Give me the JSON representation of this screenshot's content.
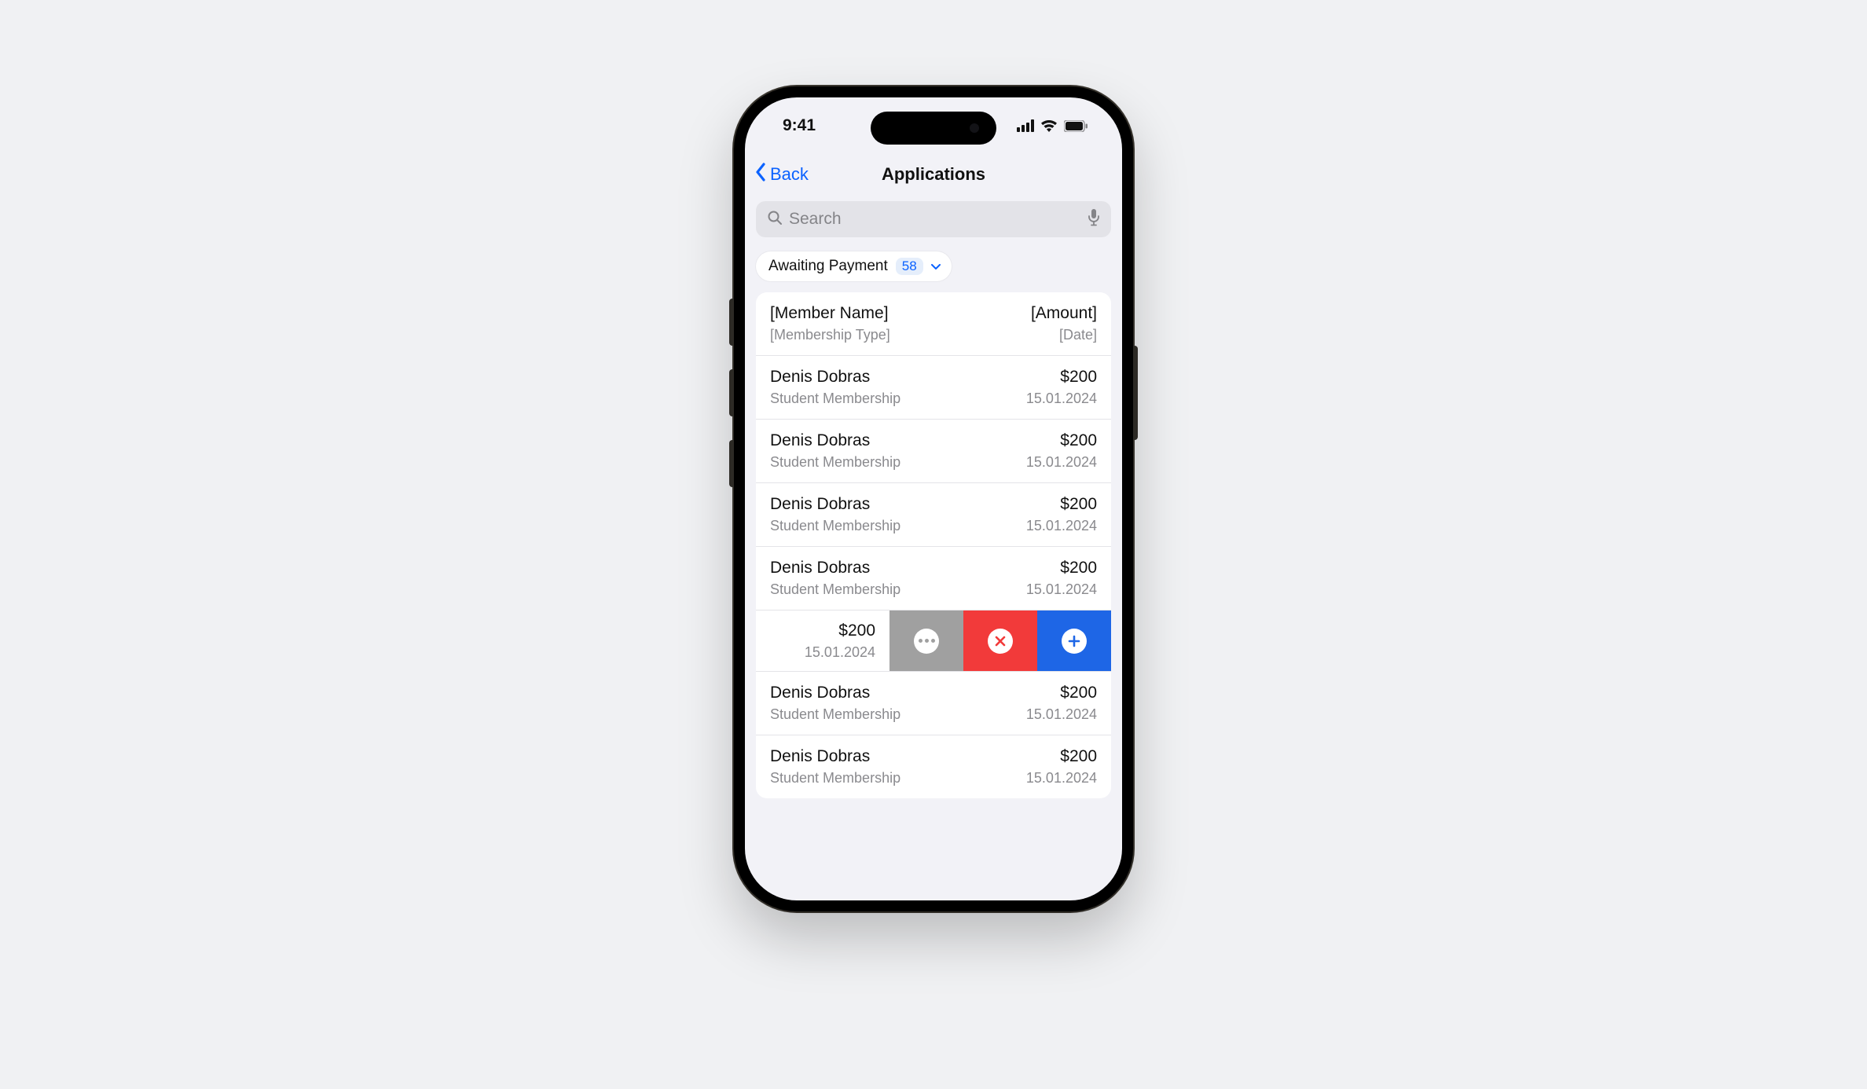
{
  "statusbar": {
    "time": "9:41"
  },
  "nav": {
    "back": "Back",
    "title": "Applications"
  },
  "search": {
    "placeholder": "Search"
  },
  "filter": {
    "label": "Awaiting Payment",
    "count": "58"
  },
  "header_row": {
    "name": "[Member Name]",
    "type": "[Membership Type]",
    "amount": "[Amount]",
    "date": "[Date]"
  },
  "rows": [
    {
      "name": "Denis Dobras",
      "type": "Student Membership",
      "amount": "$200",
      "date": "15.01.2024"
    },
    {
      "name": "Denis Dobras",
      "type": "Student Membership",
      "amount": "$200",
      "date": "15.01.2024"
    },
    {
      "name": "Denis Dobras",
      "type": "Student Membership",
      "amount": "$200",
      "date": "15.01.2024"
    },
    {
      "name": "Denis Dobras",
      "type": "Student Membership",
      "amount": "$200",
      "date": "15.01.2024"
    }
  ],
  "swiped_row": {
    "amount": "$200",
    "date": "15.01.2024"
  },
  "rows_after": [
    {
      "name": "Denis Dobras",
      "type": "Student Membership",
      "amount": "$200",
      "date": "15.01.2024"
    },
    {
      "name": "Denis Dobras",
      "type": "Student Membership",
      "amount": "$200",
      "date": "15.01.2024"
    }
  ]
}
